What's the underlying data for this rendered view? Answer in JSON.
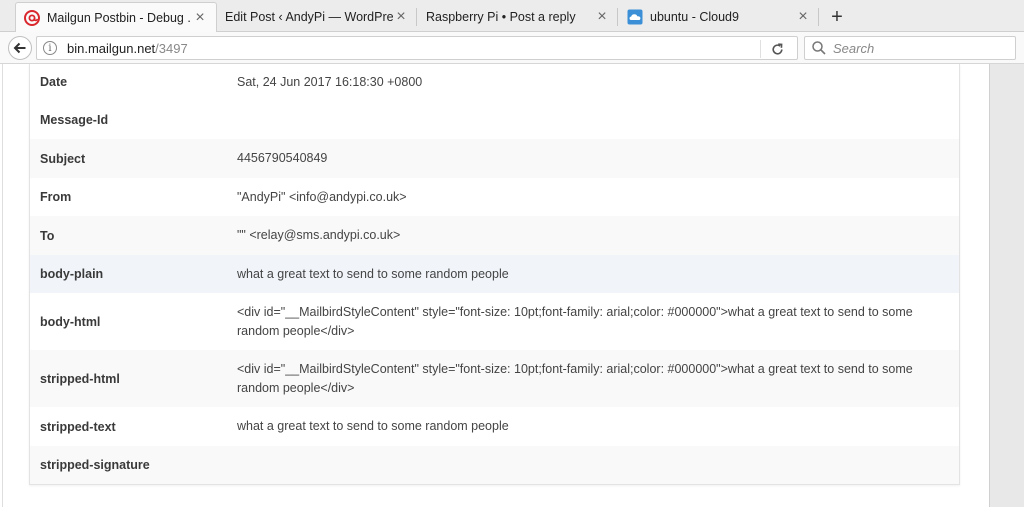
{
  "browser": {
    "tabs": [
      {
        "title": "Mailgun Postbin - Debug ...",
        "icon": "mailgun-icon",
        "active": true
      },
      {
        "title": "Edit Post ‹ AndyPi — WordPress",
        "icon": "",
        "active": false
      },
      {
        "title": "Raspberry Pi • Post a reply",
        "icon": "",
        "active": false
      },
      {
        "title": "ubuntu - Cloud9",
        "icon": "cloud9-icon",
        "active": false
      }
    ],
    "new_tab": "+",
    "url": {
      "host": "bin.mailgun.net",
      "path": "/3497"
    },
    "search_placeholder": "Search"
  },
  "rows": [
    {
      "key": "Date",
      "value": "Sat, 24 Jun 2017 16:18:30 +0800"
    },
    {
      "key": "Message-Id",
      "value": ""
    },
    {
      "key": "Subject",
      "value": "4456790540849"
    },
    {
      "key": "From",
      "value": "\"AndyPi\" <info@andypi.co.uk>"
    },
    {
      "key": "To",
      "value": "\"\" <relay@sms.andypi.co.uk>"
    },
    {
      "key": "body-plain",
      "value": "what a great text to send to some random people"
    },
    {
      "key": "body-html",
      "value": "<div id=\"__MailbirdStyleContent\" style=\"font-size: 10pt;font-family: arial;color: #000000\">what a great text to send to some random people</div>"
    },
    {
      "key": "stripped-html",
      "value": "<div id=\"__MailbirdStyleContent\" style=\"font-size: 10pt;font-family: arial;color: #000000\">what a great text to send to some random people</div>"
    },
    {
      "key": "stripped-text",
      "value": "what a great text to send to some random people"
    },
    {
      "key": "stripped-signature",
      "value": ""
    }
  ],
  "colors": {
    "mailgun": "#d9272d",
    "cloud9": "#3a8fd6",
    "row_alt": "#f9f9f9",
    "row_highlight": "#f1f5fa"
  }
}
